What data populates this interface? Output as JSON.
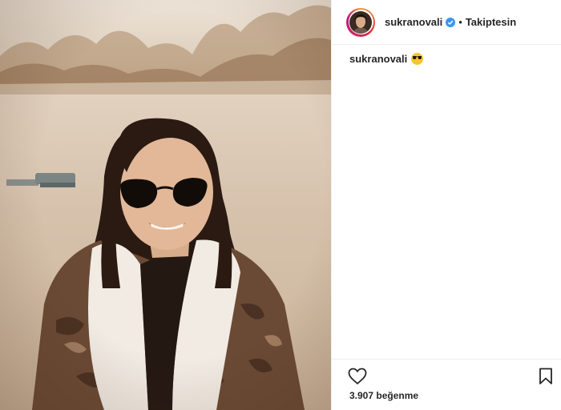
{
  "header": {
    "username": "sukranovali",
    "separator": "•",
    "follow_state": "Takiptesin"
  },
  "caption": {
    "username": "sukranovali",
    "emoji": "smiling-face-with-sunglasses"
  },
  "actions": {
    "like_icon": "heart-icon",
    "save_icon": "bookmark-icon"
  },
  "likes": {
    "text": "3.907 beğenme"
  },
  "colors": {
    "verified": "#3897f0",
    "text": "#262626",
    "border": "#efefef"
  }
}
